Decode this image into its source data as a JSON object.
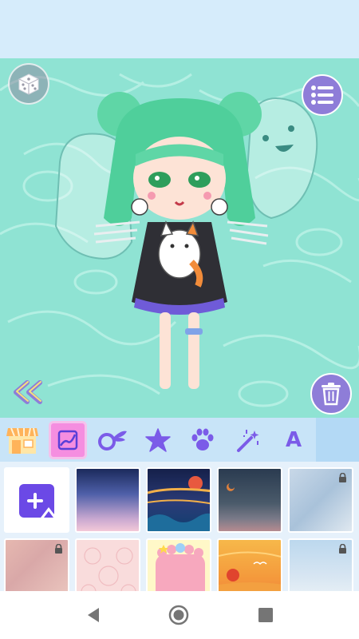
{
  "colors": {
    "accent": "#8e7dd8",
    "active_tab": "#f58ee0",
    "tab_bar": "#c8e4f8",
    "canvas_water": "#8fe3d3",
    "icon_purple": "#7b5be8"
  },
  "header": {},
  "canvas": {
    "character_icon": "chibi-girl-illustration",
    "left_buttons": [
      "dice-icon",
      "double-chevron-left-icon"
    ],
    "right_buttons": [
      "list-menu-icon",
      "trash-icon"
    ]
  },
  "category_tabs": [
    {
      "icon": "store-icon",
      "active": false
    },
    {
      "icon": "background-image-icon",
      "active": true
    },
    {
      "icon": "wing-icon",
      "active": false
    },
    {
      "icon": "star-icon",
      "active": false
    },
    {
      "icon": "paw-icon",
      "active": false
    },
    {
      "icon": "magic-wand-icon",
      "active": false
    },
    {
      "icon": "text-icon",
      "label": "A",
      "active": false
    }
  ],
  "background_grid": [
    {
      "kind": "add-custom-image",
      "locked": false
    },
    {
      "kind": "starry-gradient",
      "locked": false
    },
    {
      "kind": "night-sea-sunset",
      "locked": false
    },
    {
      "kind": "dusk-moon",
      "locked": false
    },
    {
      "kind": "watercolor-blue",
      "locked": true
    },
    {
      "kind": "watercolor-rose",
      "locked": true
    },
    {
      "kind": "pink-lace",
      "locked": false
    },
    {
      "kind": "cute-frame",
      "locked": false
    },
    {
      "kind": "orange-sunset-birds",
      "locked": false
    },
    {
      "kind": "watercolor-sky",
      "locked": true
    }
  ],
  "nav": [
    "back-icon",
    "home-icon",
    "recents-icon"
  ]
}
